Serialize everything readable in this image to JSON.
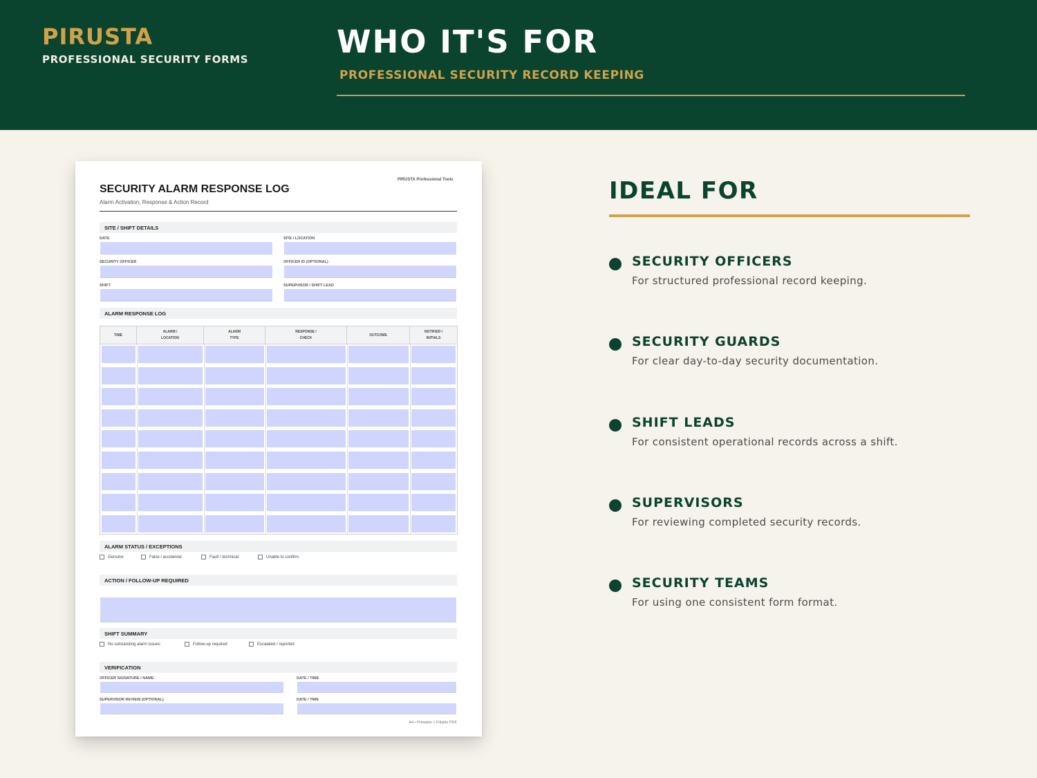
{
  "header": {
    "brand": "PIRUSTA",
    "brand_sub": "PROFESSIONAL SECURITY FORMS",
    "title": "WHO IT'S FOR",
    "subtitle": "PROFESSIONAL SECURITY RECORD KEEPING"
  },
  "form": {
    "title": "SECURITY ALARM RESPONSE LOG",
    "subtitle": "Alarm Activation, Response & Action Record",
    "brand": "PIRUSTA Professional Tools",
    "site_section": "SITE / SHIFT DETAILS",
    "fields": {
      "date": "DATE",
      "site": "SITE / LOCATION",
      "officer": "SECURITY OFFICER",
      "officer_id": "OFFICER ID (OPTIONAL)",
      "shift": "SHIFT",
      "supervisor": "SUPERVISOR / SHIFT LEAD"
    },
    "log_section": "ALARM RESPONSE LOG",
    "columns": [
      "TIME",
      "ALARM /\nLOCATION",
      "ALARM\nTYPE",
      "RESPONSE /\nCHECK",
      "OUTCOME",
      "NOTIFIED /\nINITIALS"
    ],
    "row_count": 9,
    "status_section": "ALARM STATUS / EXCEPTIONS",
    "status_options": [
      "Genuine",
      "False / accidental",
      "Fault / technical",
      "Unable to confirm"
    ],
    "action_section": "ACTION / FOLLOW-UP REQUIRED",
    "summary_section": "SHIFT SUMMARY",
    "summary_options": [
      "No outstanding alarm issues",
      "Follow-up required",
      "Escalated / reported"
    ],
    "verification_section": "VERIFICATION",
    "verify": {
      "officer_sig": "OFFICER SIGNATURE / NAME",
      "date_time_1": "DATE / TIME",
      "supervisor_review": "SUPERVISOR REVIEW (OPTIONAL)",
      "date_time_2": "DATE / TIME"
    },
    "footer": "A4 • Printable + Fillable PDF"
  },
  "ideal": {
    "title": "IDEAL FOR",
    "items": [
      {
        "name": "SECURITY OFFICERS",
        "desc": "For structured professional record keeping."
      },
      {
        "name": "SECURITY GUARDS",
        "desc": "For clear day-to-day security documentation."
      },
      {
        "name": "SHIFT LEADS",
        "desc": "For consistent operational records across a shift."
      },
      {
        "name": "SUPERVISORS",
        "desc": "For reviewing completed security records."
      },
      {
        "name": "SECURITY TEAMS",
        "desc": "For using one consistent form format."
      }
    ]
  },
  "colors": {
    "green": "#0a432e",
    "gold": "#d1a24c",
    "background": "#f6f3ec",
    "field_fill": "#d0d6fc"
  }
}
